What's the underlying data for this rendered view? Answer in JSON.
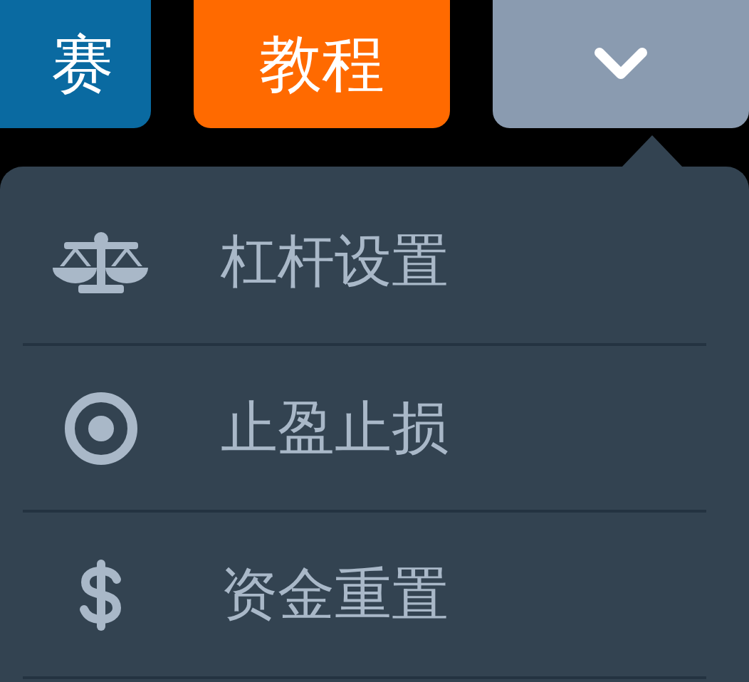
{
  "top_buttons": [
    {
      "label": "赛",
      "kind": "text",
      "color": "#0a6aa1"
    },
    {
      "label": "教程",
      "kind": "text",
      "color": "#ff6a00"
    },
    {
      "kind": "chevron",
      "color": "#8a9bb0"
    }
  ],
  "menu": {
    "items": [
      {
        "label": "杠杆设置",
        "kind": "scale"
      },
      {
        "label": "止盈止损",
        "kind": "target"
      },
      {
        "label": "资金重置",
        "kind": "dollar"
      }
    ]
  }
}
